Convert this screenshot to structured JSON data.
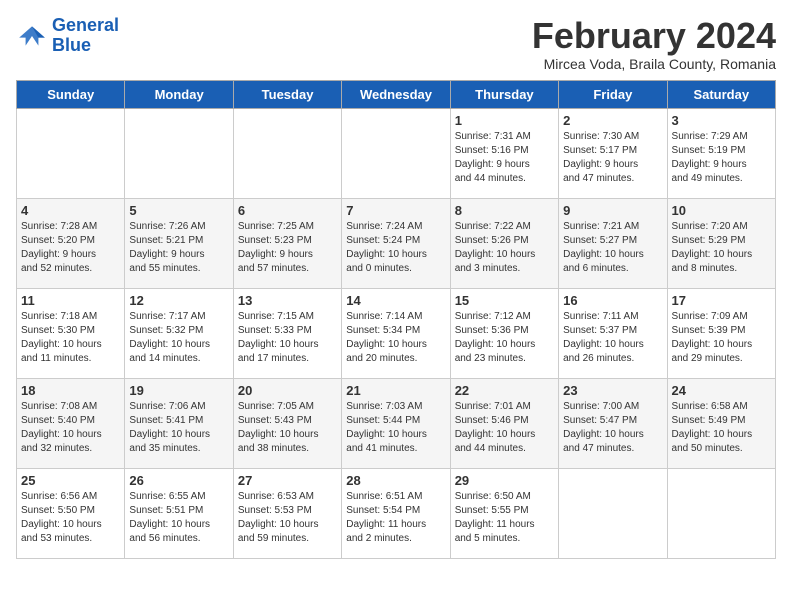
{
  "header": {
    "logo_line1": "General",
    "logo_line2": "Blue",
    "month_year": "February 2024",
    "location": "Mircea Voda, Braila County, Romania"
  },
  "weekdays": [
    "Sunday",
    "Monday",
    "Tuesday",
    "Wednesday",
    "Thursday",
    "Friday",
    "Saturday"
  ],
  "weeks": [
    [
      {
        "day": "",
        "info": ""
      },
      {
        "day": "",
        "info": ""
      },
      {
        "day": "",
        "info": ""
      },
      {
        "day": "",
        "info": ""
      },
      {
        "day": "1",
        "info": "Sunrise: 7:31 AM\nSunset: 5:16 PM\nDaylight: 9 hours\nand 44 minutes."
      },
      {
        "day": "2",
        "info": "Sunrise: 7:30 AM\nSunset: 5:17 PM\nDaylight: 9 hours\nand 47 minutes."
      },
      {
        "day": "3",
        "info": "Sunrise: 7:29 AM\nSunset: 5:19 PM\nDaylight: 9 hours\nand 49 minutes."
      }
    ],
    [
      {
        "day": "4",
        "info": "Sunrise: 7:28 AM\nSunset: 5:20 PM\nDaylight: 9 hours\nand 52 minutes."
      },
      {
        "day": "5",
        "info": "Sunrise: 7:26 AM\nSunset: 5:21 PM\nDaylight: 9 hours\nand 55 minutes."
      },
      {
        "day": "6",
        "info": "Sunrise: 7:25 AM\nSunset: 5:23 PM\nDaylight: 9 hours\nand 57 minutes."
      },
      {
        "day": "7",
        "info": "Sunrise: 7:24 AM\nSunset: 5:24 PM\nDaylight: 10 hours\nand 0 minutes."
      },
      {
        "day": "8",
        "info": "Sunrise: 7:22 AM\nSunset: 5:26 PM\nDaylight: 10 hours\nand 3 minutes."
      },
      {
        "day": "9",
        "info": "Sunrise: 7:21 AM\nSunset: 5:27 PM\nDaylight: 10 hours\nand 6 minutes."
      },
      {
        "day": "10",
        "info": "Sunrise: 7:20 AM\nSunset: 5:29 PM\nDaylight: 10 hours\nand 8 minutes."
      }
    ],
    [
      {
        "day": "11",
        "info": "Sunrise: 7:18 AM\nSunset: 5:30 PM\nDaylight: 10 hours\nand 11 minutes."
      },
      {
        "day": "12",
        "info": "Sunrise: 7:17 AM\nSunset: 5:32 PM\nDaylight: 10 hours\nand 14 minutes."
      },
      {
        "day": "13",
        "info": "Sunrise: 7:15 AM\nSunset: 5:33 PM\nDaylight: 10 hours\nand 17 minutes."
      },
      {
        "day": "14",
        "info": "Sunrise: 7:14 AM\nSunset: 5:34 PM\nDaylight: 10 hours\nand 20 minutes."
      },
      {
        "day": "15",
        "info": "Sunrise: 7:12 AM\nSunset: 5:36 PM\nDaylight: 10 hours\nand 23 minutes."
      },
      {
        "day": "16",
        "info": "Sunrise: 7:11 AM\nSunset: 5:37 PM\nDaylight: 10 hours\nand 26 minutes."
      },
      {
        "day": "17",
        "info": "Sunrise: 7:09 AM\nSunset: 5:39 PM\nDaylight: 10 hours\nand 29 minutes."
      }
    ],
    [
      {
        "day": "18",
        "info": "Sunrise: 7:08 AM\nSunset: 5:40 PM\nDaylight: 10 hours\nand 32 minutes."
      },
      {
        "day": "19",
        "info": "Sunrise: 7:06 AM\nSunset: 5:41 PM\nDaylight: 10 hours\nand 35 minutes."
      },
      {
        "day": "20",
        "info": "Sunrise: 7:05 AM\nSunset: 5:43 PM\nDaylight: 10 hours\nand 38 minutes."
      },
      {
        "day": "21",
        "info": "Sunrise: 7:03 AM\nSunset: 5:44 PM\nDaylight: 10 hours\nand 41 minutes."
      },
      {
        "day": "22",
        "info": "Sunrise: 7:01 AM\nSunset: 5:46 PM\nDaylight: 10 hours\nand 44 minutes."
      },
      {
        "day": "23",
        "info": "Sunrise: 7:00 AM\nSunset: 5:47 PM\nDaylight: 10 hours\nand 47 minutes."
      },
      {
        "day": "24",
        "info": "Sunrise: 6:58 AM\nSunset: 5:49 PM\nDaylight: 10 hours\nand 50 minutes."
      }
    ],
    [
      {
        "day": "25",
        "info": "Sunrise: 6:56 AM\nSunset: 5:50 PM\nDaylight: 10 hours\nand 53 minutes."
      },
      {
        "day": "26",
        "info": "Sunrise: 6:55 AM\nSunset: 5:51 PM\nDaylight: 10 hours\nand 56 minutes."
      },
      {
        "day": "27",
        "info": "Sunrise: 6:53 AM\nSunset: 5:53 PM\nDaylight: 10 hours\nand 59 minutes."
      },
      {
        "day": "28",
        "info": "Sunrise: 6:51 AM\nSunset: 5:54 PM\nDaylight: 11 hours\nand 2 minutes."
      },
      {
        "day": "29",
        "info": "Sunrise: 6:50 AM\nSunset: 5:55 PM\nDaylight: 11 hours\nand 5 minutes."
      },
      {
        "day": "",
        "info": ""
      },
      {
        "day": "",
        "info": ""
      }
    ]
  ]
}
